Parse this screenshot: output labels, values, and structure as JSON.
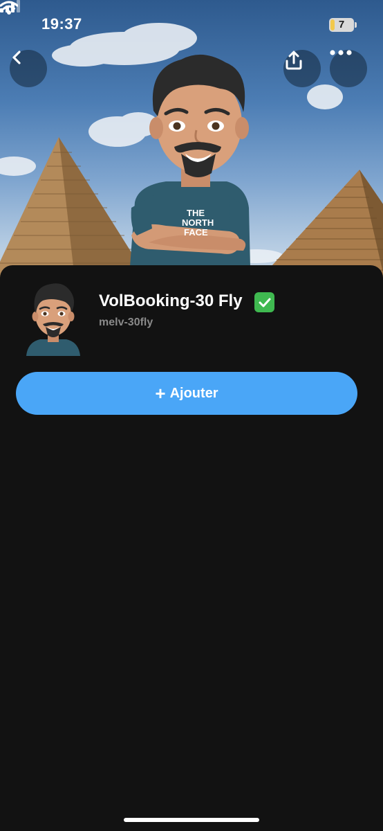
{
  "status_bar": {
    "time": "19:37",
    "battery_level": "7",
    "icons": [
      "signal-icon",
      "wifi-icon",
      "battery-icon"
    ]
  },
  "header": {
    "back_icon": "chevron-left-icon",
    "share_icon": "share-upload-icon",
    "more_icon": "more-dots-icon"
  },
  "profile": {
    "display_name": "VolBooking-30 Fly",
    "verified_icon": "verified-check-icon",
    "username": "melv-30fly",
    "shirt_text_line1": "THE",
    "shirt_text_line2": "NORTH",
    "shirt_text_line3": "FACE"
  },
  "actions": {
    "add_button_icon": "+",
    "add_button_label": "Ajouter"
  },
  "colors": {
    "accent": "#4aa6f7",
    "background": "#121212",
    "verified": "#3fb950",
    "username": "#8a8a8a"
  }
}
